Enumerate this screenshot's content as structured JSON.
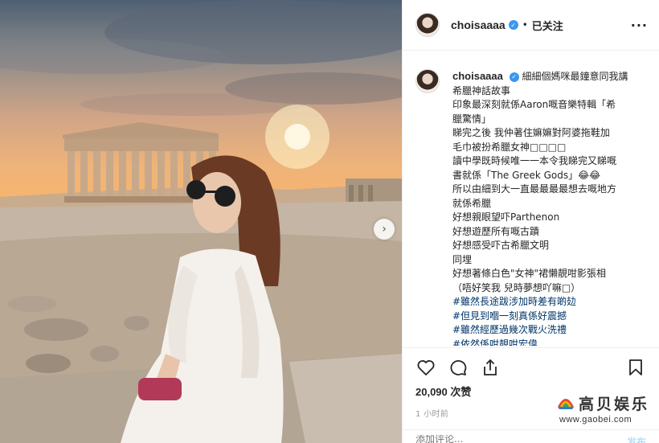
{
  "header": {
    "username": "choisaaaa",
    "separator": "•",
    "follow_status": "已关注",
    "more_icon": "more-horizontal-icon",
    "more_glyph": "···"
  },
  "photo": {
    "next_glyph": "›",
    "next_icon": "chevron-right-icon"
  },
  "caption": {
    "username": "choisaaaa",
    "lines": [
      "細細個媽咪最鐘意同我講",
      "希臘神話故事",
      "印象最深刻就係Aaron嘅音樂特輯「希",
      "臘驚情」",
      "睇完之後 我仲著住嫲嫲對阿婆拖鞋加",
      "毛巾被扮希臘女神□□□□",
      "讀中學既時候唯一一本令我睇完又睇嘅",
      "書就係「The Greek Gods」😂😂",
      "所以由細到大一直最最最最想去嘅地方",
      "就係希臘",
      "好想親眼望吓Parthenon",
      "好想遊歷所有嘅古蹟",
      "好想感受吓古希臘文明",
      "同埋",
      "好想著條白色\"女神\"裙懶靚咁影張相",
      "（唔好笑我 兒時夢想吖嘛□）"
    ],
    "hashtags": [
      "#雖然長途跋涉加時差有啲攰",
      "#但見到嗰一刻真係好震撼",
      "#雖然經歷過幾次戰火洗禮",
      "#依然係咁靚咁宏偉"
    ]
  },
  "actions": {
    "like_icon": "heart-icon",
    "comment_icon": "comment-icon",
    "share_icon": "share-icon",
    "save_icon": "bookmark-icon",
    "likes_count": "20,090",
    "likes_label": "次赞",
    "time_ago": "1 小时前"
  },
  "comment": {
    "placeholder": "添加评论...",
    "post_label": "发布"
  },
  "watermark": {
    "site_name": "高贝娱乐",
    "url": "www.gaobei.com"
  },
  "colors": {
    "hashtag": "#003569",
    "verified": "#3897f0",
    "muted": "#999999",
    "post_button": "#b2dffc"
  }
}
